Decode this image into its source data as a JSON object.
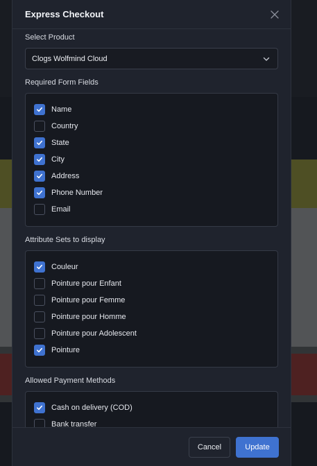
{
  "modal": {
    "title": "Express Checkout"
  },
  "product": {
    "label": "Select Product",
    "selected": "Clogs Wolfmind Cloud"
  },
  "form_fields": {
    "label": "Required Form Fields",
    "items": [
      {
        "label": "Name",
        "checked": true
      },
      {
        "label": "Country",
        "checked": false
      },
      {
        "label": "State",
        "checked": true
      },
      {
        "label": "City",
        "checked": true
      },
      {
        "label": "Address",
        "checked": true
      },
      {
        "label": "Phone Number",
        "checked": true
      },
      {
        "label": "Email",
        "checked": false
      }
    ]
  },
  "attribute_sets": {
    "label": "Attribute Sets to display",
    "items": [
      {
        "label": "Couleur",
        "checked": true
      },
      {
        "label": "Pointure pour Enfant",
        "checked": false
      },
      {
        "label": "Pointure pour Femme",
        "checked": false
      },
      {
        "label": "Pointure pour Homme",
        "checked": false
      },
      {
        "label": "Pointure pour Adolescent",
        "checked": false
      },
      {
        "label": "Pointure",
        "checked": true
      }
    ]
  },
  "payment_methods": {
    "label": "Allowed Payment Methods",
    "items": [
      {
        "label": "Cash on delivery (COD)",
        "checked": true
      },
      {
        "label": "Bank transfer",
        "checked": false
      }
    ]
  },
  "footer": {
    "cancel_label": "Cancel",
    "update_label": "Update"
  },
  "colors": {
    "accent": "#3f72d0",
    "modal_bg": "#1f232d",
    "panel_bg": "#161920"
  },
  "icons": {
    "close": "close-icon",
    "dropdown": "chevron-down-icon",
    "check": "check-icon"
  }
}
